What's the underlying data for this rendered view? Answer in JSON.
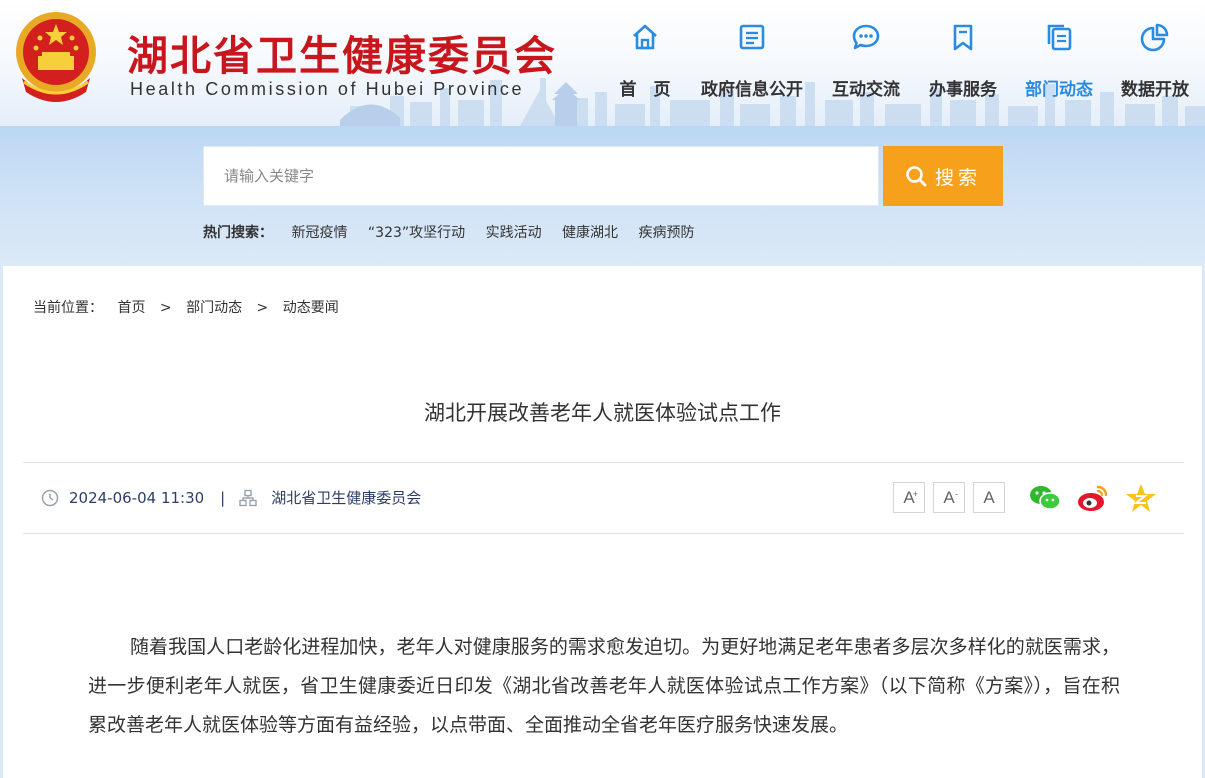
{
  "header": {
    "title": "湖北省卫生健康委员会",
    "subtitle": "Health Commission of Hubei Province"
  },
  "nav": {
    "items": [
      {
        "label": "首　页",
        "icon": "home-icon"
      },
      {
        "label": "政府信息公开",
        "icon": "document-icon"
      },
      {
        "label": "互动交流",
        "icon": "chat-icon"
      },
      {
        "label": "办事服务",
        "icon": "bookmark-icon"
      },
      {
        "label": "部门动态",
        "icon": "copy-icon",
        "active": true
      },
      {
        "label": "数据开放",
        "icon": "pie-chart-icon"
      }
    ],
    "active_color": "#2a8be0"
  },
  "search": {
    "placeholder": "请输入关键字",
    "button_label": "搜索",
    "button_color": "#f7a01c",
    "hot_label": "热门搜索：",
    "hot_items": [
      "新冠疫情",
      "“323”攻坚行动",
      "实践活动",
      "健康湖北",
      "疾病预防"
    ]
  },
  "breadcrumb": {
    "prefix": "当前位置：",
    "items": [
      "首页",
      "部门动态",
      "动态要闻"
    ],
    "separator": ">"
  },
  "article": {
    "title": "湖北开展改善老年人就医体验试点工作",
    "datetime": "2024-06-04 11:30",
    "meta_separator": "|",
    "source": "湖北省卫生健康委员会",
    "font_buttons": [
      "A",
      "A",
      "A"
    ],
    "paragraph": "随着我国人口老龄化进程加快，老年人对健康服务的需求愈发迫切。为更好地满足老年患者多层次多样化的就医需求，进一步便利老年人就医，省卫生健康委近日印发《湖北省改善老年人就医体验试点工作方案》（以下简称《方案》），旨在积累改善老年人就医体验等方面有益经验，以点带面、全面推动全省老年医疗服务快速发展。"
  },
  "share": [
    "wechat-icon",
    "weibo-icon",
    "qzone-icon"
  ],
  "colors": {
    "title_red": "#c8161d",
    "search_orange": "#f7a01c",
    "active_blue": "#2a8be0"
  }
}
